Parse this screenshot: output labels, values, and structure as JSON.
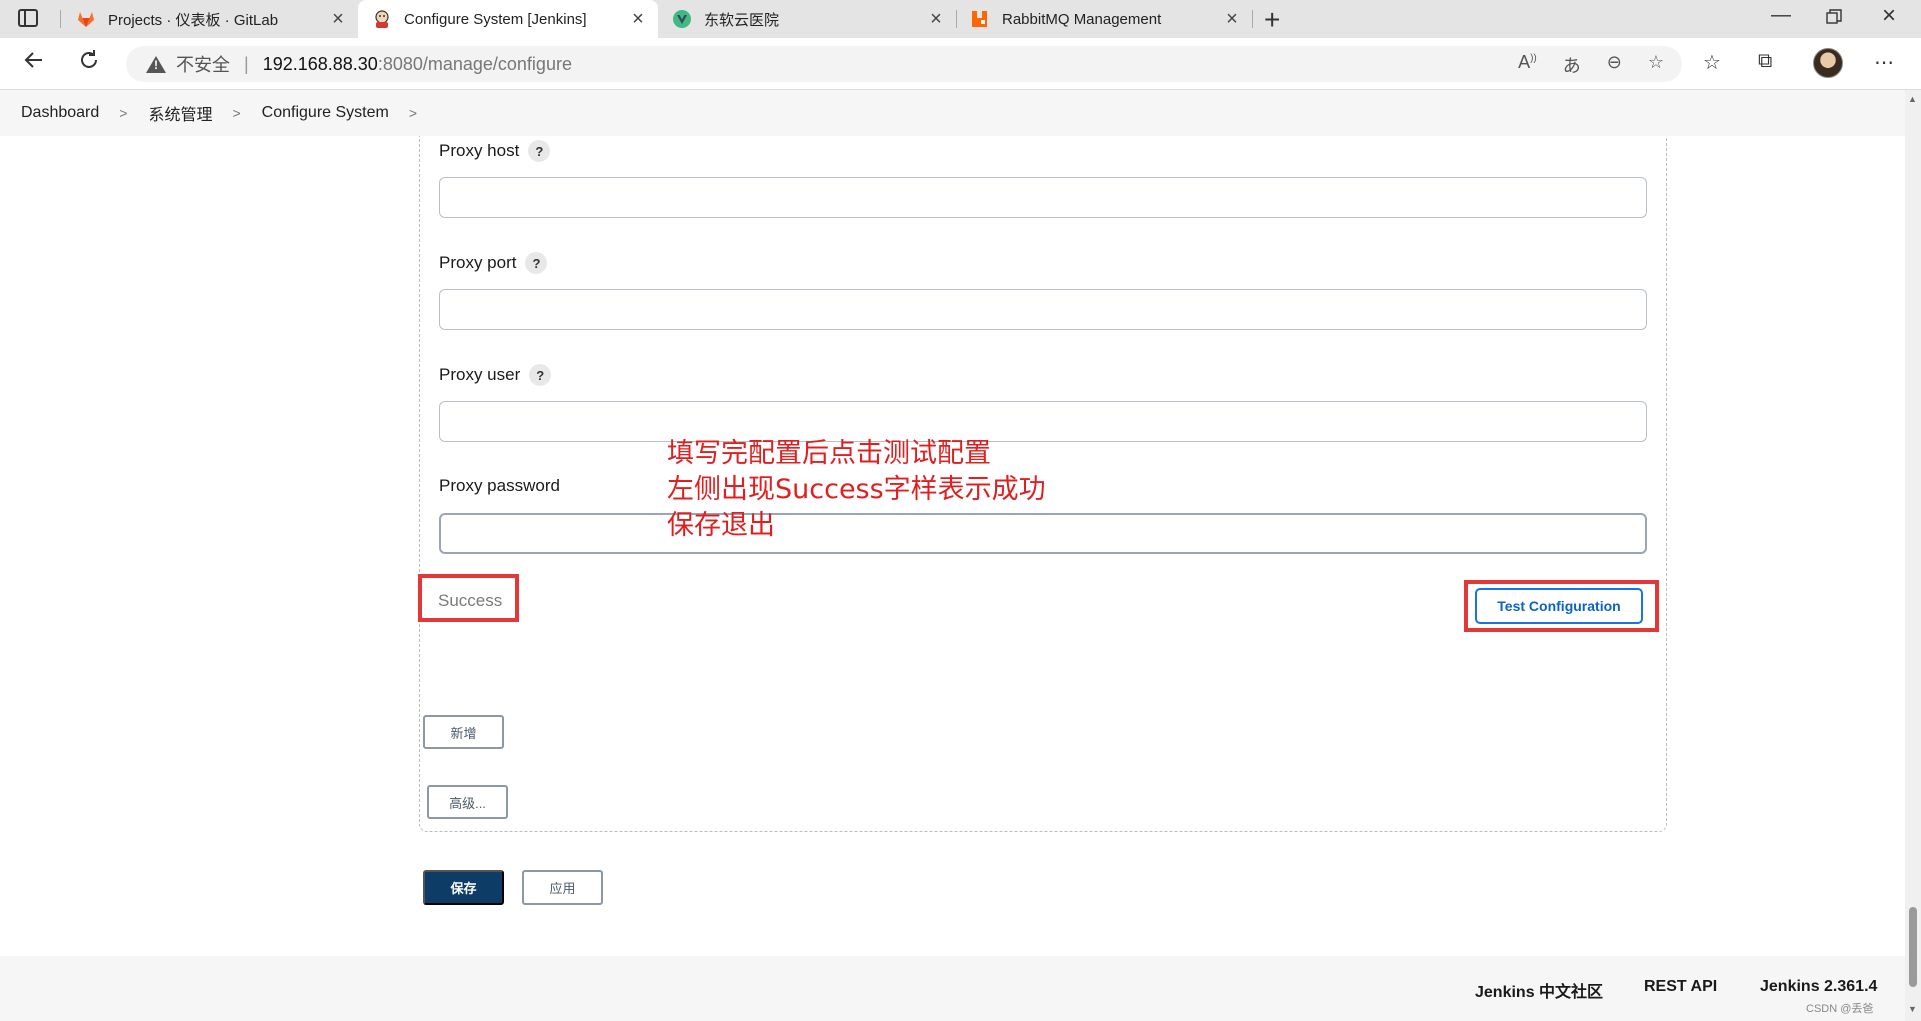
{
  "browser": {
    "tabs": [
      {
        "title": "Projects · 仪表板 · GitLab",
        "icon": "gitlab-icon"
      },
      {
        "title": "Configure System [Jenkins]",
        "icon": "jenkins-icon"
      },
      {
        "title": "东软云医院",
        "icon": "vue-icon"
      },
      {
        "title": "RabbitMQ Management",
        "icon": "rabbitmq-icon"
      }
    ],
    "security_label": "不安全",
    "url_host": "192.168.88.30",
    "url_rest": ":8080/manage/configure"
  },
  "breadcrumb": {
    "items": [
      "Dashboard",
      "系统管理",
      "Configure System"
    ]
  },
  "form": {
    "proxy_host_label": "Proxy host",
    "proxy_port_label": "Proxy port",
    "proxy_user_label": "Proxy user",
    "proxy_password_label": "Proxy password",
    "help_glyph": "?",
    "proxy_host_value": "",
    "proxy_port_value": "",
    "proxy_user_value": "",
    "proxy_password_value": "",
    "status_text": "Success",
    "test_button_label": "Test Configuration",
    "add_button_label": "新增",
    "advanced_button_label": "高级...",
    "save_button_label": "保存",
    "apply_button_label": "应用"
  },
  "annotation": {
    "line1": "填写完配置后点击测试配置",
    "line2": "左侧出现Success字样表示成功",
    "line3": "保存退出",
    "color": "#e02020"
  },
  "footer": {
    "community": "Jenkins 中文社区",
    "rest_api": "REST API",
    "version": "Jenkins 2.361.4"
  },
  "watermark": "CSDN @丢爸",
  "colors": {
    "accent": "#1a73e8",
    "primary_button": "#0d3d66",
    "highlight_frame": "#e43737"
  }
}
